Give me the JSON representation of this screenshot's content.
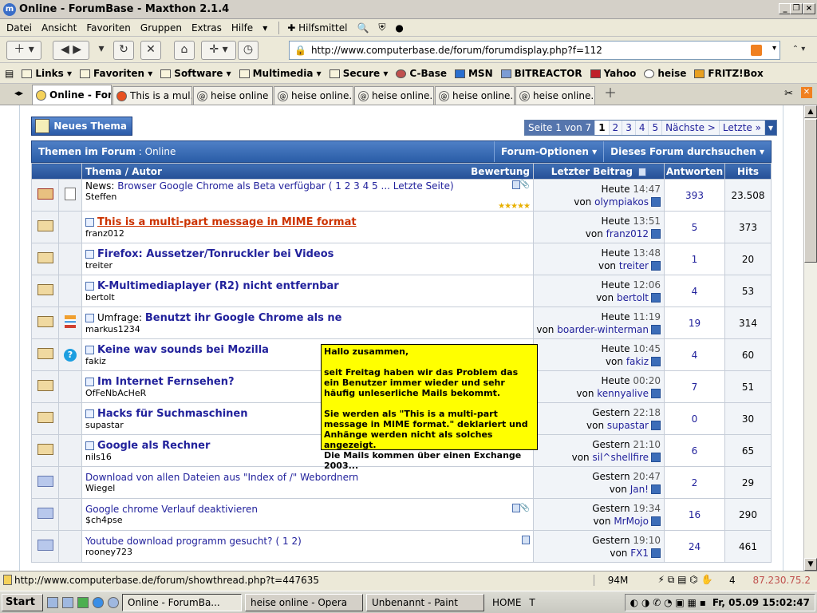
{
  "window": {
    "title": "Online - ForumBase - Maxthon 2.1.4"
  },
  "menu": [
    "Datei",
    "Ansicht",
    "Favoriten",
    "Gruppen",
    "Extras",
    "Hilfe"
  ],
  "hilfsmittel": "Hilfsmittel",
  "address": "http://www.computerbase.de/forum/forumdisplay.php?f=112",
  "favorites": [
    "Links",
    "Favoriten",
    "Software",
    "Multimedia",
    "Secure",
    "C-Base",
    "MSN",
    "BITREACTOR",
    "Yahoo",
    "heise",
    "FRITZ!Box"
  ],
  "tabs": [
    "Online - For...",
    "This is a mul...",
    "heise online",
    "heise online...",
    "heise online...",
    "heise online...",
    "heise online..."
  ],
  "forum": {
    "new_thread": "Neues Thema",
    "pager": {
      "label": "Seite 1 von 7",
      "pages": [
        "1",
        "2",
        "3",
        "4",
        "5"
      ],
      "next": "Nächste >",
      "last": "Letzte »"
    },
    "header_title": "Themen im Forum",
    "header_sub": " : Online",
    "options": "Forum-Optionen ▾",
    "search": "Dieses Forum durchsuchen ▾",
    "cols": {
      "topic": "Thema / Autor",
      "rating": "Bewertung",
      "last": "Letzter Beitrag",
      "replies": "Antworten",
      "hits": "Hits"
    },
    "rows": [
      {
        "prefix": "News: ",
        "title": "Browser Google Chrome als Beta verfügbar",
        "pages": "( 1 2 3 4 5 ... Letzte Seite)",
        "author": "Steffen",
        "day": "Heute",
        "time": "14:47",
        "by": "olympiakos",
        "replies": "393",
        "hits": "23.508"
      },
      {
        "prefix": "",
        "title": "This is a multi-part message in MIME format",
        "pages": "",
        "author": "franz012",
        "day": "Heute",
        "time": "13:51",
        "by": "franz012",
        "replies": "5",
        "hits": "373"
      },
      {
        "prefix": "",
        "title": "Firefox: Aussetzer/Tonruckler bei Videos",
        "pages": "",
        "author": "treiter",
        "day": "Heute",
        "time": "13:48",
        "by": "treiter",
        "replies": "1",
        "hits": "20"
      },
      {
        "prefix": "",
        "title": "K-Multimediaplayer (R2) nicht entfernbar",
        "pages": "",
        "author": "bertolt",
        "day": "Heute",
        "time": "12:06",
        "by": "bertolt",
        "replies": "4",
        "hits": "53"
      },
      {
        "prefix": "Umfrage: ",
        "title": "Benutzt ihr Google Chrome als ne",
        "pages": "",
        "author": "markus1234",
        "day": "Heute",
        "time": "11:19",
        "by": "boarder-winterman",
        "replies": "19",
        "hits": "314"
      },
      {
        "prefix": "",
        "title": "Keine wav sounds bei Mozilla",
        "pages": "",
        "author": "fakiz",
        "day": "Heute",
        "time": "10:45",
        "by": "fakiz",
        "replies": "4",
        "hits": "60"
      },
      {
        "prefix": "",
        "title": "Im Internet Fernsehen?",
        "pages": "",
        "author": "OfFeNbAcHeR",
        "day": "Heute",
        "time": "00:20",
        "by": "kennyalive",
        "replies": "7",
        "hits": "51"
      },
      {
        "prefix": "",
        "title": "Hacks für Suchmaschinen",
        "pages": "",
        "author": "supastar",
        "day": "Gestern",
        "time": "22:18",
        "by": "supastar",
        "replies": "0",
        "hits": "30"
      },
      {
        "prefix": "",
        "title": "Google als Rechner",
        "pages": "",
        "author": "nils16",
        "day": "Gestern",
        "time": "21:10",
        "by": "sil^shellfire",
        "replies": "6",
        "hits": "65"
      },
      {
        "prefix": "",
        "title": "Download von allen Dateien aus \"Index of /\" Webordnern",
        "pages": "",
        "author": "Wiegel",
        "day": "Gestern",
        "time": "20:47",
        "by": "Jan!",
        "replies": "2",
        "hits": "29"
      },
      {
        "prefix": "",
        "title": "Google chrome Verlauf deaktivieren",
        "pages": "",
        "author": "$ch4pse",
        "day": "Gestern",
        "time": "19:34",
        "by": "MrMojo",
        "replies": "16",
        "hits": "290"
      },
      {
        "prefix": "",
        "title": "Youtube download programm gesucht?",
        "pages": "( 1 2)",
        "author": "rooney723",
        "day": "Gestern",
        "time": "19:10",
        "by": "FX1",
        "replies": "24",
        "hits": "461"
      }
    ],
    "von": "von"
  },
  "tooltip": [
    "Hallo zusammen,",
    "seit Freitag haben wir das Problem das ein Benutzer immer wieder und sehr häufig unleserliche Mails bekommt.",
    "Sie werden als \"This is a multi-part message in MIME format.\" deklariert und Anhänge werden nicht als solches angezeigt.\nDie Mails kommen über einen Exchange 2003..."
  ],
  "status": {
    "url": "http://www.computerbase.de/forum/showthread.php?t=447635",
    "mem": "94M",
    "count": "4",
    "ip": "87.230.75.2"
  },
  "taskbar": {
    "start": "Start",
    "items": [
      "Online - ForumBa...",
      "heise online - Opera",
      "Unbenannt - Paint"
    ],
    "home": "HOME",
    "t": "T",
    "clock": "Fr, 05.09 15:02:47"
  }
}
